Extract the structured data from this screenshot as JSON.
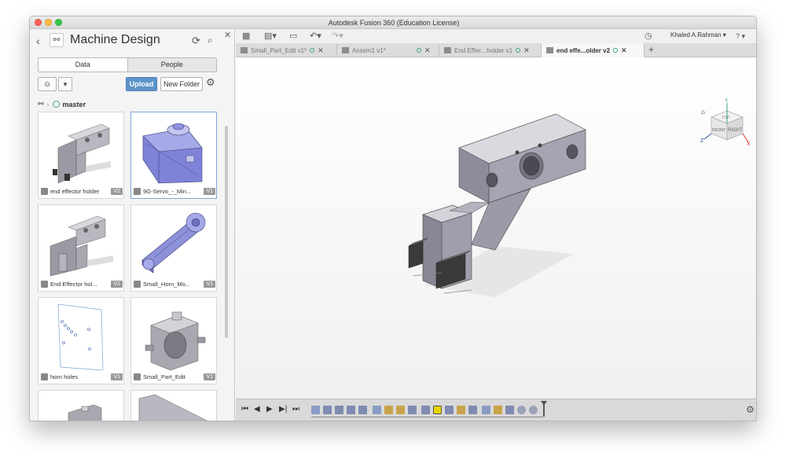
{
  "window_title": "Autodesk Fusion 360 (Education License)",
  "panel": {
    "project_title": "Machine Design",
    "tabs": [
      "Data",
      "People"
    ],
    "upload_label": "Upload",
    "new_folder_label": "New Folder",
    "breadcrumb": "master",
    "files": [
      {
        "name": "end effector holder",
        "version": "V2"
      },
      {
        "name": "9G-Servo_-_Min...",
        "version": "V1"
      },
      {
        "name": "End Effector hol...",
        "version": "V1"
      },
      {
        "name": "Small_Horn_Mo...",
        "version": "V1"
      },
      {
        "name": "horn holes",
        "version": "V1"
      },
      {
        "name": "Small_Part_Edit",
        "version": "V1"
      }
    ]
  },
  "toolbar": {
    "user": "Khaled A.Rahman ▾",
    "help": "? ▾"
  },
  "doc_tabs": [
    {
      "name": "Small_Part_Edit v1*"
    },
    {
      "name": "Assem1 v1*"
    },
    {
      "name": "End Effec...holder v1"
    },
    {
      "name": "end effe...older v2"
    }
  ],
  "viewcube": {
    "top": "TOP",
    "front": "FRONT",
    "right": "RIGHT",
    "axis_x": "X",
    "axis_y": "Y",
    "axis_z": "Z"
  },
  "colors": {
    "accent": "#5c93c9",
    "selected_feature": "#e8d400",
    "status_dot": "#3aa876"
  }
}
